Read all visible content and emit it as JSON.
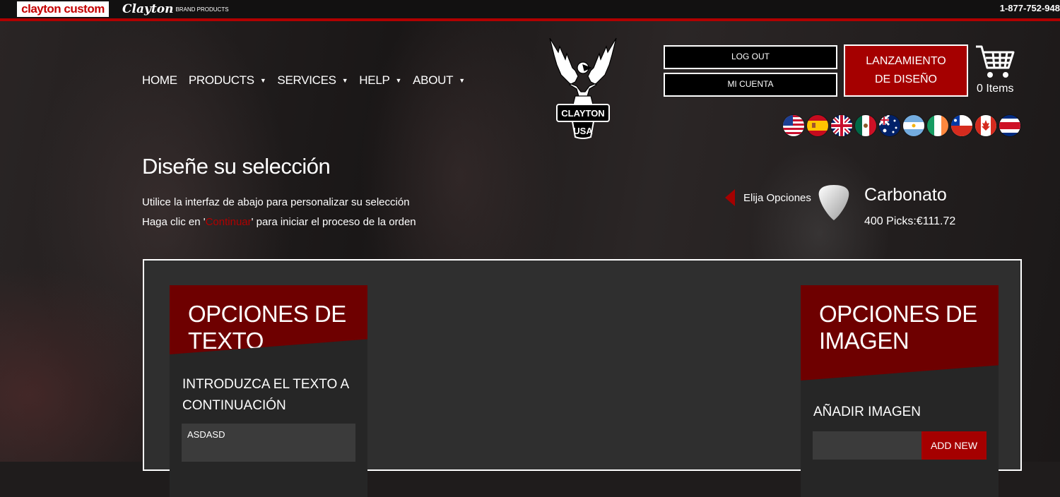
{
  "topbar": {
    "brand_custom": "clayton custom",
    "brand_script": "Clayton",
    "brand_small": "BRAND PRODUCTS",
    "phone": "1-877-752-948"
  },
  "nav": [
    {
      "label": "HOME",
      "has_caret": false
    },
    {
      "label": "PRODUCTS",
      "has_caret": true
    },
    {
      "label": "SERVICES",
      "has_caret": true
    },
    {
      "label": "HELP",
      "has_caret": true
    },
    {
      "label": "ABOUT",
      "has_caret": true
    }
  ],
  "logo": {
    "name": "CLAYTON",
    "badge": "USA"
  },
  "account": {
    "logout_label": "LOG OUT",
    "account_label": "MI CUENTA",
    "launch_line1": "LANZAMIENTO",
    "launch_line2": "DE DISEÑO",
    "cart_label": "0 Items"
  },
  "flags": [
    "us-flag-icon",
    "spain-flag-icon",
    "uk-flag-icon",
    "mexico-flag-icon",
    "australia-flag-icon",
    "argentina-flag-icon",
    "ireland-flag-icon",
    "chile-flag-icon",
    "canada-flag-icon",
    "costa-rica-flag-icon"
  ],
  "intro": {
    "title": "Diseñe su selección",
    "line1": "Utilice la interfaz de abajo para personalizar su selección",
    "line2_before": "Haga clic en '",
    "line2_link": "Continuar",
    "line2_after": "' para iniciar el proceso de la orden"
  },
  "product": {
    "back_label": "Elija Opciones",
    "name": "Carbonato",
    "price": "400 Picks:€111.72"
  },
  "text_options": {
    "heading": "OPCIONES DE TEXTO",
    "field_label_1": "INTRODUZCA EL TEXTO A",
    "field_label_2": "CONTINUACIÓN",
    "value": "ASDASD"
  },
  "image_options": {
    "heading_1": "OPCIONES DE",
    "heading_2": "IMAGEN",
    "field_label": "AÑADIR IMAGEN",
    "add_label": "ADD NEW"
  },
  "colors": {
    "accent": "#a50000",
    "panel_head": "#6e0000",
    "panel_bg": "#2f2f2f"
  }
}
